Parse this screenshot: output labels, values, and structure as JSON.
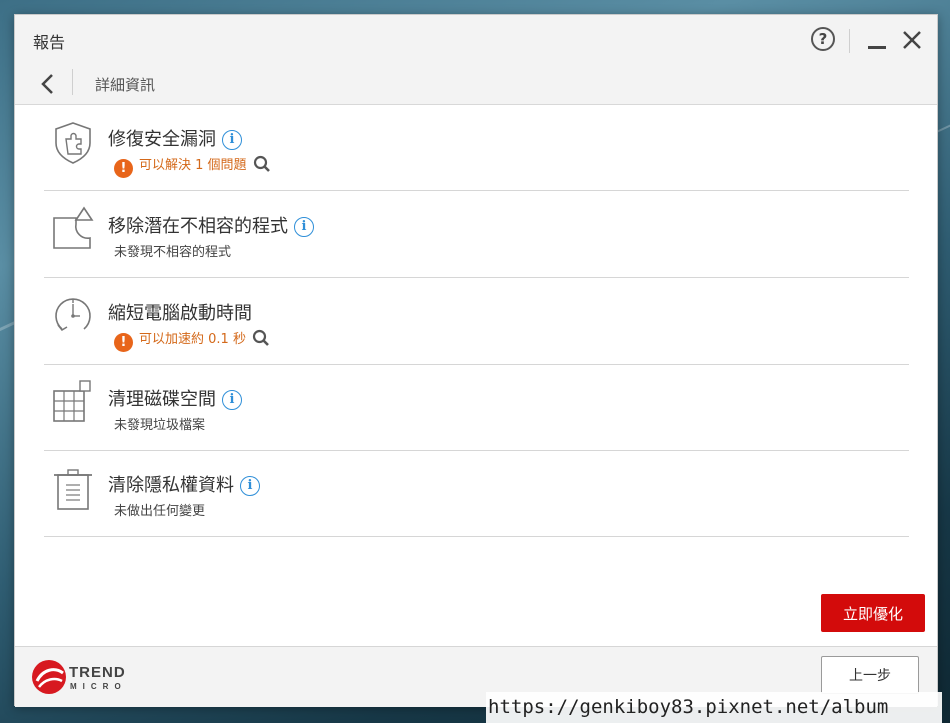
{
  "window": {
    "title": "報告"
  },
  "nav": {
    "title": "詳細資訊"
  },
  "items": [
    {
      "title": "修復安全漏洞",
      "status": "可以解決 1 個問題",
      "status_type": "warning",
      "icon": "shield-puzzle-icon"
    },
    {
      "title": "移除潛在不相容的程式",
      "status": "未發現不相容的程式",
      "status_type": "info",
      "icon": "incompatible-program-icon"
    },
    {
      "title": "縮短電腦啟動時間",
      "status": "可以加速約 0.1 秒",
      "status_type": "warning",
      "icon": "startup-clock-icon"
    },
    {
      "title": "清理磁碟空間",
      "status": "未發現垃圾檔案",
      "status_type": "info",
      "icon": "disk-grid-icon"
    },
    {
      "title": "清除隱私權資料",
      "status": "未做出任何變更",
      "status_type": "info",
      "icon": "trash-document-icon"
    }
  ],
  "actions": {
    "optimize": "立即優化",
    "previous": "上一步"
  },
  "logo": {
    "line1": "TREND",
    "line2": "MICRO"
  },
  "watermark": "https://genkiboy83.pixnet.net/album",
  "colors": {
    "accent_red": "#d30b0b",
    "warning_orange": "#e8651a",
    "info_blue": "#2f8fd8"
  }
}
